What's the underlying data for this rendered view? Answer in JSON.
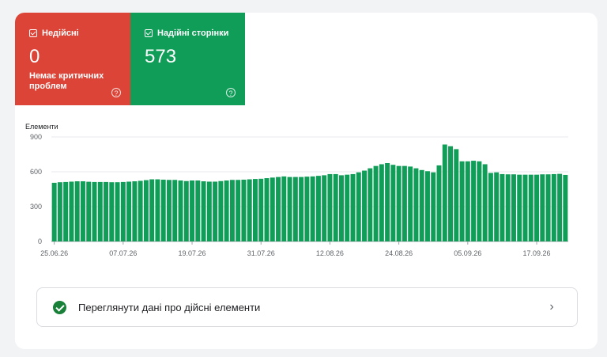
{
  "tiles": {
    "invalid": {
      "label": "Недійсні",
      "value": "0",
      "sub": "Немає критичних проблем",
      "color": "#db4437",
      "help_icon": "help-icon"
    },
    "valid": {
      "label": "Надійні сторінки",
      "value": "573",
      "color": "#0f9d58",
      "help_icon": "help-icon"
    }
  },
  "chart_data": {
    "type": "bar",
    "ylabel": "Елементи",
    "ylim": [
      0,
      900
    ],
    "yticks": [
      0,
      300,
      600,
      900
    ],
    "xtick_labels": [
      "25.06.26",
      "07.07.26",
      "19.07.26",
      "31.07.26",
      "12.08.26",
      "24.08.26",
      "05.09.26",
      "17.09.26"
    ],
    "bar_color": "#0f9d58",
    "values": [
      505,
      510,
      512,
      515,
      518,
      518,
      514,
      512,
      512,
      512,
      510,
      510,
      512,
      515,
      518,
      522,
      528,
      535,
      535,
      532,
      530,
      530,
      525,
      520,
      525,
      525,
      518,
      515,
      515,
      520,
      525,
      530,
      530,
      532,
      535,
      538,
      540,
      545,
      550,
      555,
      560,
      555,
      555,
      555,
      558,
      560,
      565,
      570,
      580,
      580,
      570,
      575,
      580,
      595,
      610,
      630,
      650,
      665,
      675,
      660,
      650,
      650,
      645,
      630,
      615,
      605,
      595,
      655,
      835,
      820,
      795,
      690,
      690,
      695,
      690,
      665,
      590,
      595,
      580,
      578,
      578,
      575,
      575,
      575,
      575,
      578,
      578,
      580,
      582,
      573
    ]
  },
  "footer": {
    "link_label": "Переглянути дані про дійсні елементи",
    "status_icon": "check-circle-icon",
    "chevron_icon": "chevron-right-icon"
  }
}
